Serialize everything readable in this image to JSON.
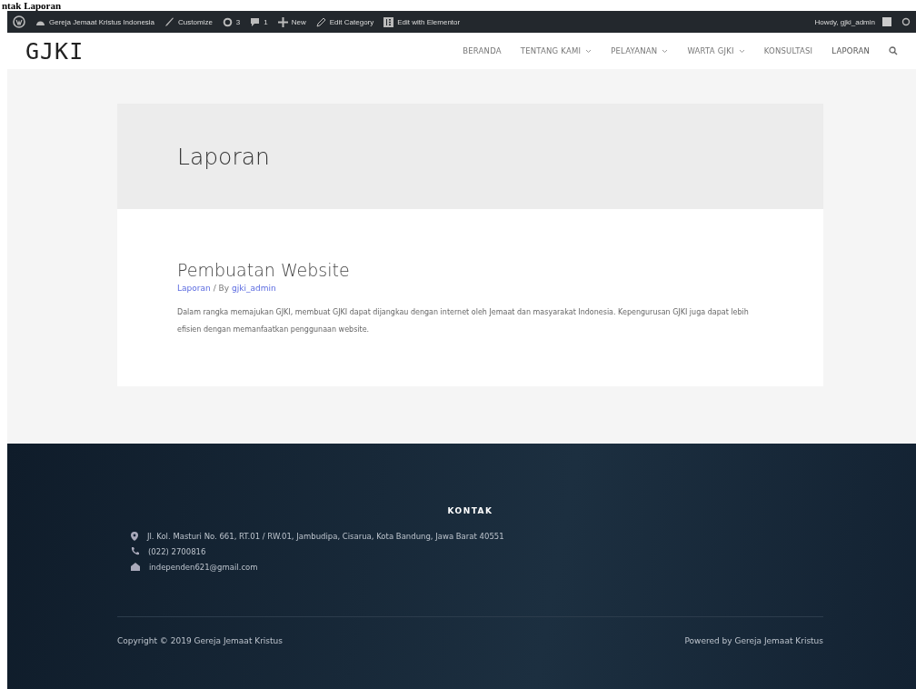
{
  "page_caption": "ntak Laporan",
  "admin_bar": {
    "site": "Gereja Jemaat Kristus Indonesia",
    "items": [
      {
        "kind": "customize",
        "label": "Customize"
      },
      {
        "kind": "updates",
        "label": "3"
      },
      {
        "kind": "comments",
        "label": "1"
      },
      {
        "kind": "new",
        "label": "New"
      },
      {
        "kind": "edit",
        "label": "Edit Category"
      },
      {
        "kind": "elementor",
        "label": "Edit with Elementor"
      }
    ],
    "greeting": "Howdy, gjki_admin"
  },
  "header": {
    "logo": "GJKI",
    "menu": [
      {
        "label": "BERANDA",
        "dropdown": false,
        "selected": false
      },
      {
        "label": "TENTANG KAMI",
        "dropdown": true,
        "selected": false
      },
      {
        "label": "PELAYANAN",
        "dropdown": true,
        "selected": false
      },
      {
        "label": "WARTA GJKI",
        "dropdown": true,
        "selected": false
      },
      {
        "label": "KONSULTASI",
        "dropdown": false,
        "selected": false
      },
      {
        "label": "LAPORAN",
        "dropdown": false,
        "selected": true
      }
    ]
  },
  "page_title": "Laporan",
  "post": {
    "title": "Pembuatan Website",
    "category": "Laporan",
    "by": "/ By",
    "author": "gjki_admin",
    "excerpt": "Dalam rangka memajukan GJKI, membuat GJKI dapat dijangkau dengan internet oleh Jemaat dan masyarakat Indonesia. Kepengurusan GJKI juga dapat lebih efisien dengan memanfaatkan penggunaan website."
  },
  "footer": {
    "heading": "KONTAK",
    "contacts": [
      {
        "kind": "address",
        "text": "Jl. Kol. Masturi No. 661, RT.01 / RW.01, Jambudipa, Cisarua, Kota Bandung, Jawa Barat 40551"
      },
      {
        "kind": "phone",
        "text": "(022) 2700816"
      },
      {
        "kind": "email",
        "text": "independen621@gmail.com"
      }
    ],
    "copyright": "Copyright © 2019 Gereja Jemaat Kristus",
    "powered": "Powered by Gereja Jemaat Kristus"
  }
}
